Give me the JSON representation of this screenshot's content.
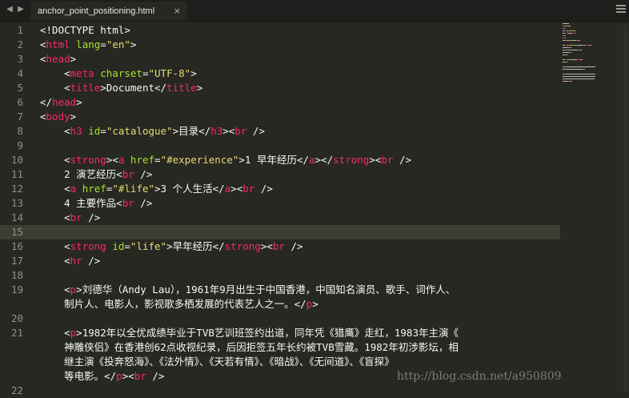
{
  "tab": {
    "title": "anchor_point_positioning.html",
    "close": "×"
  },
  "nav": {
    "back": "◀",
    "forward": "▶"
  },
  "colors": {
    "background": "#272822",
    "tag": "#f92672",
    "attribute": "#a6e22e",
    "string": "#e6db74",
    "text": "#f8f8f2",
    "line_highlight": "#3e3d32"
  },
  "line_numbers": [
    "1",
    "2",
    "3",
    "4",
    "5",
    "6",
    "7",
    "8",
    "9",
    "10",
    "11",
    "12",
    "13",
    "14",
    "15",
    "16",
    "17",
    "18",
    "19",
    "",
    "20",
    "21",
    "",
    "",
    "",
    "22"
  ],
  "lines": [
    [
      [
        "p",
        "<!DOCTYPE html>"
      ]
    ],
    [
      [
        "p",
        "<"
      ],
      [
        "t",
        "html"
      ],
      [
        "p",
        " "
      ],
      [
        "a",
        "lang"
      ],
      [
        "p",
        "="
      ],
      [
        "s",
        "\"en\""
      ],
      [
        "p",
        ">"
      ]
    ],
    [
      [
        "p",
        "<"
      ],
      [
        "t",
        "head"
      ],
      [
        "p",
        ">"
      ]
    ],
    [
      [
        "p",
        "    <"
      ],
      [
        "t",
        "meta"
      ],
      [
        "p",
        " "
      ],
      [
        "a",
        "charset"
      ],
      [
        "p",
        "="
      ],
      [
        "s",
        "\"UTF-8\""
      ],
      [
        "p",
        ">"
      ]
    ],
    [
      [
        "p",
        "    <"
      ],
      [
        "t",
        "title"
      ],
      [
        "p",
        ">Document</"
      ],
      [
        "t",
        "title"
      ],
      [
        "p",
        ">"
      ]
    ],
    [
      [
        "p",
        "</"
      ],
      [
        "t",
        "head"
      ],
      [
        "p",
        ">"
      ]
    ],
    [
      [
        "p",
        "<"
      ],
      [
        "t",
        "body"
      ],
      [
        "p",
        ">"
      ]
    ],
    [
      [
        "p",
        "    <"
      ],
      [
        "t",
        "h3"
      ],
      [
        "p",
        " "
      ],
      [
        "a",
        "id"
      ],
      [
        "p",
        "="
      ],
      [
        "s",
        "\"catalogue\""
      ],
      [
        "p",
        ">目录</"
      ],
      [
        "t",
        "h3"
      ],
      [
        "p",
        "><"
      ],
      [
        "t",
        "br"
      ],
      [
        "p",
        " />"
      ]
    ],
    [],
    [
      [
        "p",
        "    <"
      ],
      [
        "t",
        "strong"
      ],
      [
        "p",
        "><"
      ],
      [
        "t",
        "a"
      ],
      [
        "p",
        " "
      ],
      [
        "a",
        "href"
      ],
      [
        "p",
        "="
      ],
      [
        "s",
        "\"#experience\""
      ],
      [
        "p",
        ">1 早年经历</"
      ],
      [
        "t",
        "a"
      ],
      [
        "p",
        "></"
      ],
      [
        "t",
        "strong"
      ],
      [
        "p",
        "><"
      ],
      [
        "t",
        "br"
      ],
      [
        "p",
        " />"
      ]
    ],
    [
      [
        "p",
        "    2 演艺经历<"
      ],
      [
        "t",
        "br"
      ],
      [
        "p",
        " />"
      ]
    ],
    [
      [
        "p",
        "    <"
      ],
      [
        "t",
        "a"
      ],
      [
        "p",
        " "
      ],
      [
        "a",
        "href"
      ],
      [
        "p",
        "="
      ],
      [
        "s",
        "\"#life\""
      ],
      [
        "p",
        ">3 个人生活</"
      ],
      [
        "t",
        "a"
      ],
      [
        "p",
        "><"
      ],
      [
        "t",
        "br"
      ],
      [
        "p",
        " />"
      ]
    ],
    [
      [
        "p",
        "    4 主要作品<"
      ],
      [
        "t",
        "br"
      ],
      [
        "p",
        " />"
      ]
    ],
    [
      [
        "p",
        "    <"
      ],
      [
        "t",
        "br"
      ],
      [
        "p",
        " />"
      ]
    ],
    [],
    [
      [
        "p",
        "    <"
      ],
      [
        "t",
        "strong"
      ],
      [
        "p",
        " "
      ],
      [
        "a",
        "id"
      ],
      [
        "p",
        "="
      ],
      [
        "s",
        "\"life\""
      ],
      [
        "p",
        ">早年经历</"
      ],
      [
        "t",
        "strong"
      ],
      [
        "p",
        "><"
      ],
      [
        "t",
        "br"
      ],
      [
        "p",
        " />"
      ]
    ],
    [
      [
        "p",
        "    <"
      ],
      [
        "t",
        "hr"
      ],
      [
        "p",
        " />"
      ]
    ],
    [],
    [
      [
        "p",
        "    <"
      ],
      [
        "t",
        "p"
      ],
      [
        "p",
        ">刘德华（Andy Lau），1961年9月出生于中国香港，中国知名演员、歌手、词作人、"
      ]
    ],
    [
      [
        "p",
        "    制片人、电影人，影视歌多栖发展的代表艺人之一。</"
      ],
      [
        "t",
        "p"
      ],
      [
        "p",
        ">"
      ]
    ],
    [],
    [
      [
        "p",
        "    <"
      ],
      [
        "t",
        "p"
      ],
      [
        "p",
        ">1982年以全优成绩毕业于TVB艺训班签约出道，同年凭《猎鹰》走红，1983年主演《"
      ]
    ],
    [
      [
        "p",
        "    神雕侠侣》在香港创62点收视纪录，后因拒签五年长约被TVB雪藏。1982年初涉影坛，相"
      ]
    ],
    [
      [
        "p",
        "    继主演《投奔怒海》、《法外情》、《天若有情》、《暗战》、《无间道》、《盲探》"
      ]
    ],
    [
      [
        "p",
        "    等电影。</"
      ],
      [
        "t",
        "p"
      ],
      [
        "p",
        "><"
      ],
      [
        "t",
        "br"
      ],
      [
        "p",
        " />"
      ]
    ],
    []
  ],
  "watermark": "http://blog.csdn.net/a950809"
}
